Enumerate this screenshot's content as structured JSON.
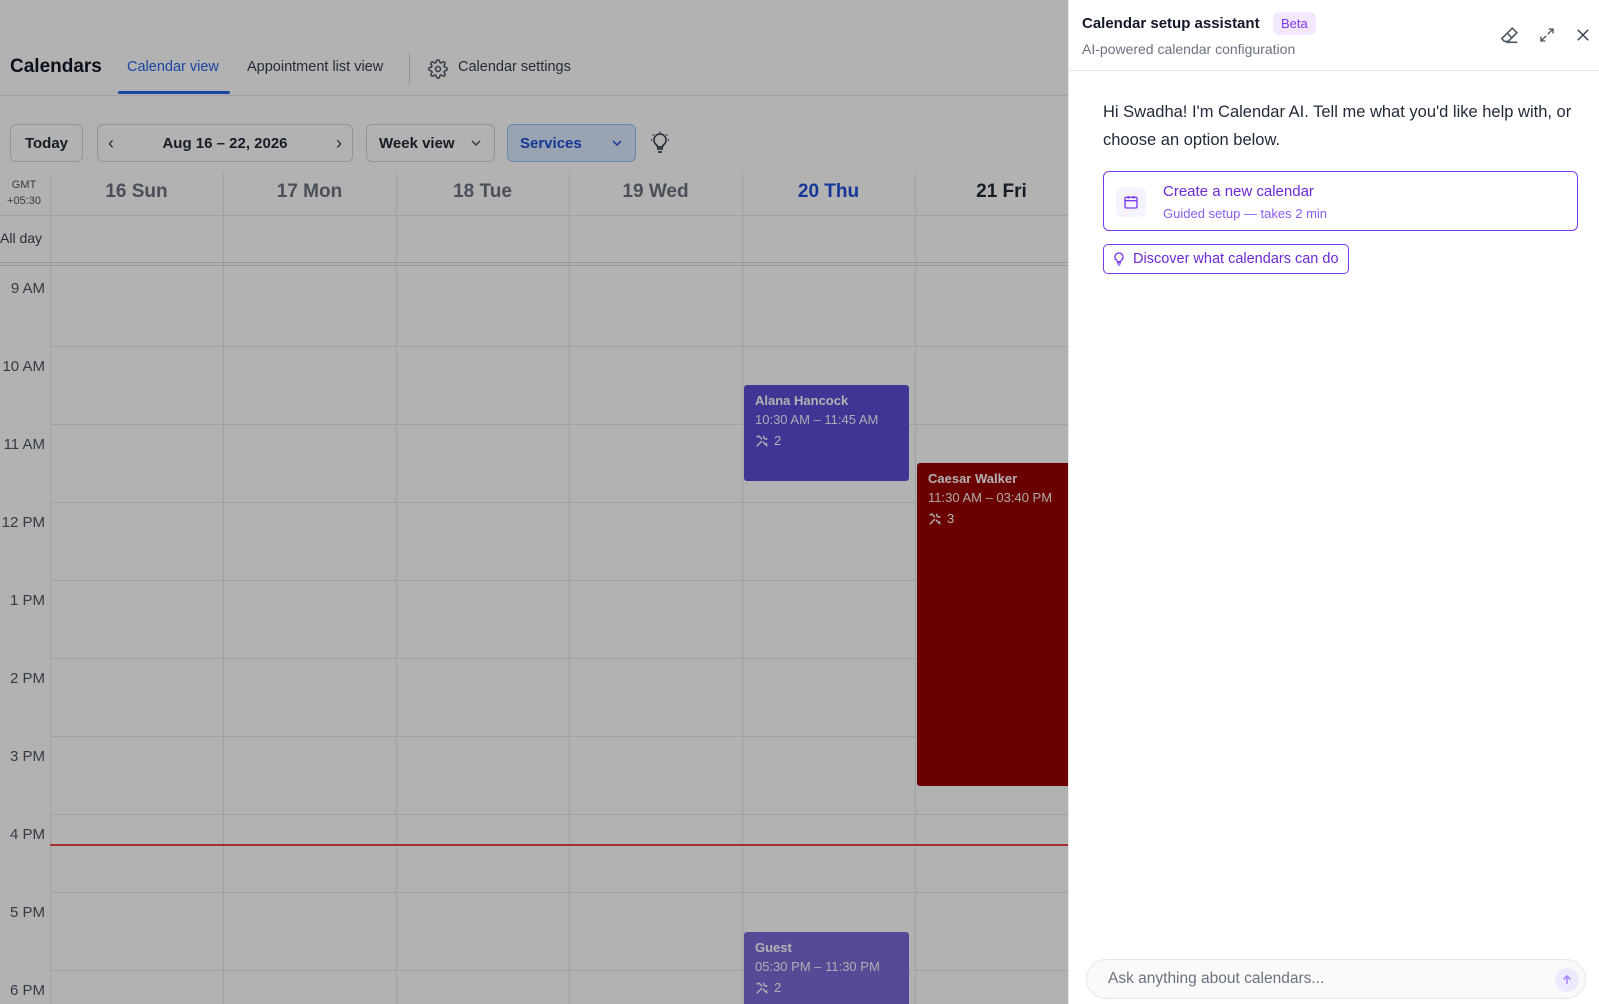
{
  "header": {
    "title": "Calendars",
    "tabs": [
      {
        "label": "Calendar view"
      },
      {
        "label": "Appointment list view"
      },
      {
        "label": "Calendar settings"
      }
    ]
  },
  "toolbar": {
    "today_label": "Today",
    "date_range": "Aug 16 – 22, 2026",
    "view_select": "Week view",
    "filter_select": "Services"
  },
  "grid": {
    "timezone_line1": "GMT",
    "timezone_line2": "+05:30",
    "all_day_label": "All day",
    "days": [
      "16 Sun",
      "17 Mon",
      "18 Tue",
      "19 Wed",
      "20 Thu",
      "21 Fri"
    ],
    "today_index": 4,
    "hours": [
      "9 AM",
      "10 AM",
      "11 AM",
      "12 PM",
      "1 PM",
      "2 PM",
      "3 PM",
      "4 PM",
      "5 PM",
      "6 PM"
    ]
  },
  "events": [
    {
      "name": "Alana Hancock",
      "time": "10:30 AM – 11:45 AM",
      "count": "2"
    },
    {
      "name": "Caesar Walker",
      "time": "11:30 AM – 03:40 PM",
      "count": "3"
    },
    {
      "name": "Guest",
      "time": "05:30 PM – 11:30 PM",
      "count": "2"
    }
  ],
  "assistant": {
    "title": "Calendar setup assistant",
    "badge": "Beta",
    "subtitle": "AI-powered calendar configuration",
    "greeting": "Hi Swadha! I'm Calendar AI. Tell me what you'd like help with, or choose an option below.",
    "option_primary_title": "Create a new calendar",
    "option_primary_sub": "Guided setup — takes 2 min",
    "option_secondary": "Discover what calendars can do",
    "input_placeholder": "Ask anything about calendars..."
  },
  "colors": {
    "accent": "#2563eb",
    "assistant_accent": "#7c3aed",
    "event_alana": "#5b4dd6",
    "event_caesar": "#9a0000",
    "event_guest": "#7c6ad9",
    "now_line": "#ef4444"
  }
}
